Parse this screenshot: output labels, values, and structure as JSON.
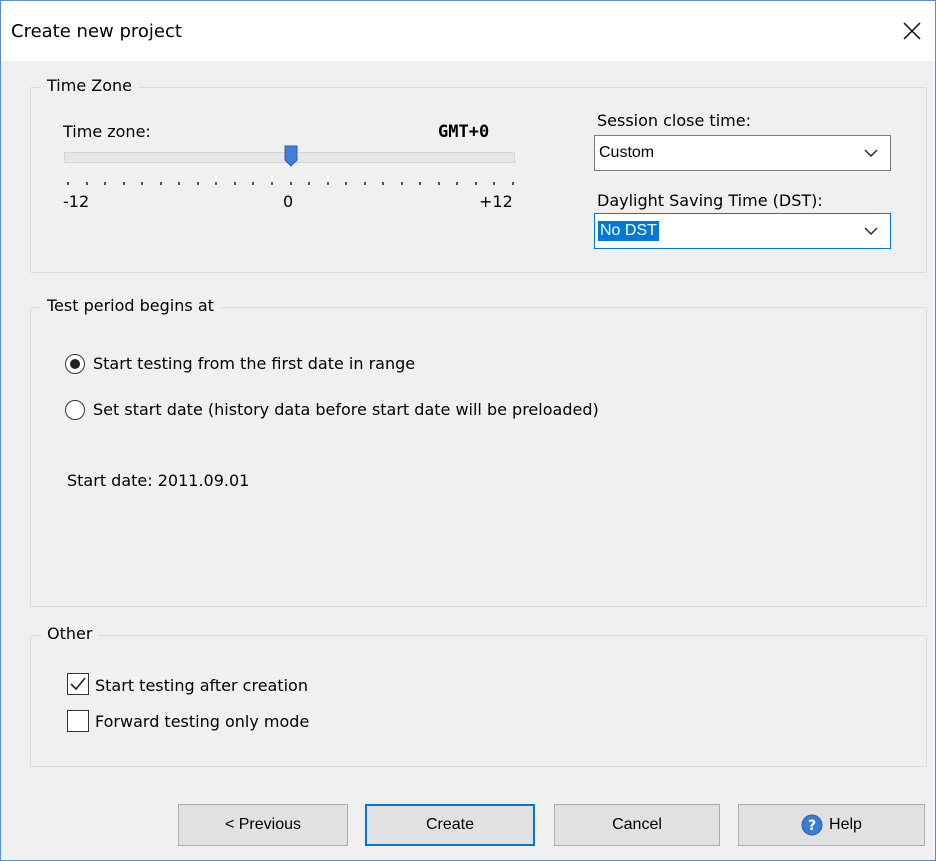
{
  "window": {
    "title": "Create new project"
  },
  "timezone_group": {
    "label": "Time Zone",
    "time_zone_label": "Time zone:",
    "value_display": "GMT+0",
    "slider": {
      "min": -12,
      "max": 12,
      "value": 0,
      "tick_count": 25
    },
    "min_label": "-12",
    "mid_label": "0",
    "max_label": "+12",
    "session_close_label": "Session close time:",
    "session_close_value": "Custom",
    "dst_label": "Daylight Saving Time (DST):",
    "dst_value": "No DST"
  },
  "test_period_group": {
    "label": "Test period begins at",
    "options": [
      {
        "label": "Start testing from the first date in range",
        "selected": true
      },
      {
        "label": "Set start date (history data before start date will be preloaded)",
        "selected": false
      }
    ],
    "start_date_text": "Start date: 2011.09.01"
  },
  "other_group": {
    "label": "Other",
    "options": [
      {
        "label": "Start testing after creation",
        "checked": true
      },
      {
        "label": "Forward testing only mode",
        "checked": false
      }
    ]
  },
  "buttons": {
    "previous": "< Previous",
    "create": "Create",
    "cancel": "Cancel",
    "help": "Help"
  },
  "colors": {
    "accent": "#0078d7",
    "slider_thumb": "#3f7fd9",
    "help_icon": "#3a7bd5"
  }
}
